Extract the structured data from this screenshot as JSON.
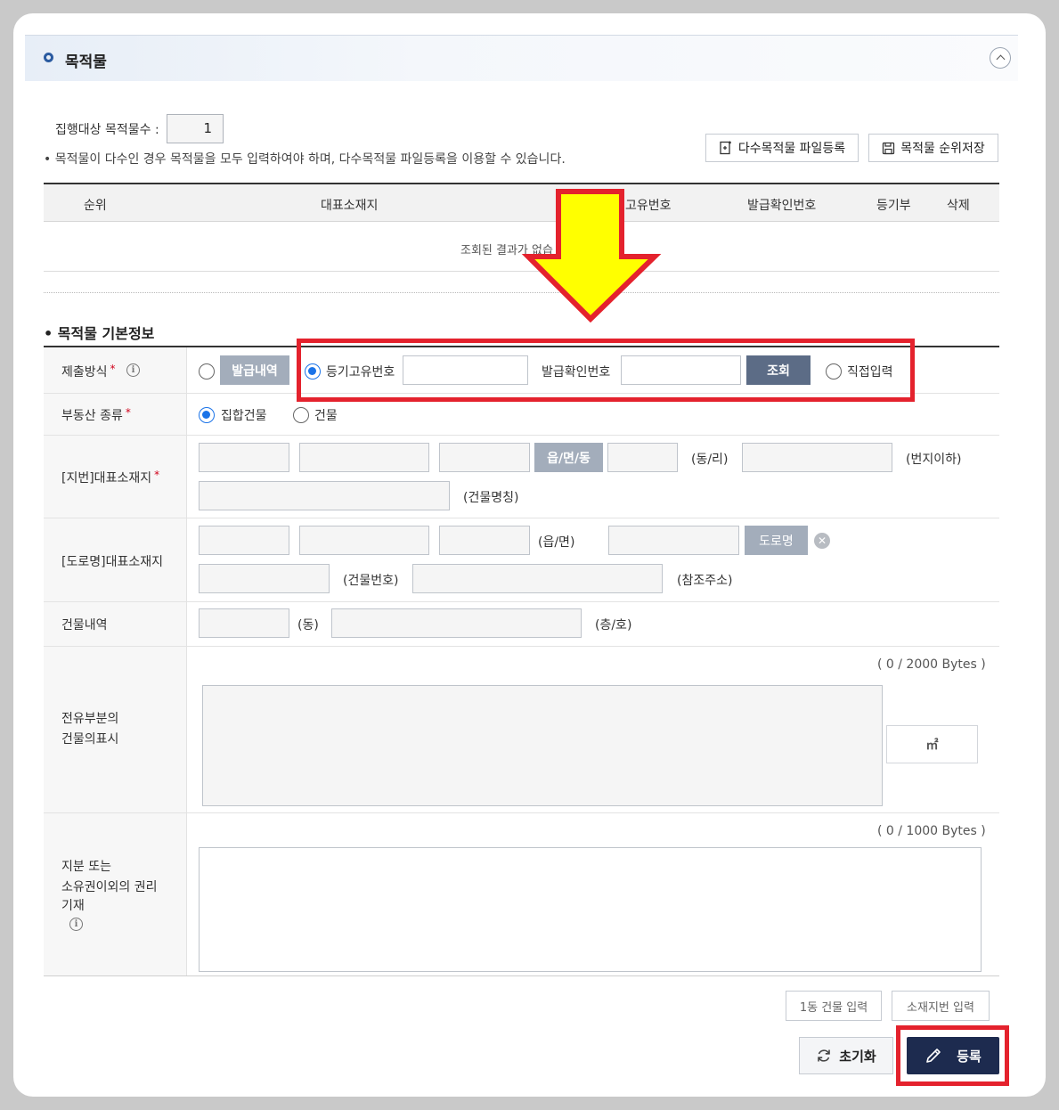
{
  "panel": {
    "title": "목적물"
  },
  "target_count": {
    "label": "집행대상 목적물수 :",
    "value": "1"
  },
  "notice": "목적물이 다수인 경우 목적물을 모두 입력하여야 하며, 다수목적물 파일등록을 이용할 수 있습니다.",
  "toolbar": {
    "bulk_upload": "다수목적물 파일등록",
    "save_order": "목적물 순위저장"
  },
  "grid": {
    "columns": [
      "순위",
      "대표소재지",
      "고유번호",
      "발급확인번호",
      "등기부",
      "삭제"
    ],
    "empty_message": "조회된 결과가 없습"
  },
  "basic_info": {
    "section_title": "목적물 기본정보",
    "submit_method": {
      "label": "제출방식",
      "issue_history": "발급내역",
      "registry_number": "등기고유번호",
      "issue_confirm_number": "발급확인번호",
      "search": "조회",
      "direct_input": "직접입력"
    },
    "property_type": {
      "label": "부동산 종류",
      "options": [
        "집합건물",
        "건물"
      ]
    },
    "lot_address": {
      "label": "[지번]대표소재지",
      "town_button": "읍/면/동",
      "dong_ri": "(동/리)",
      "lot_number": "(번지이하)",
      "building_name": "(건물명칭)"
    },
    "road_address": {
      "label": "[도로명]대표소재지",
      "eup_myeon": "(읍/면)",
      "road_button": "도로명",
      "building_number": "(건물번호)",
      "reference_address": "(참조주소)"
    },
    "building_detail": {
      "label": "건물내역",
      "dong": "(동)",
      "floor_ho": "(층/호)"
    },
    "exclusive_part": {
      "label_line1": "전유부분의",
      "label_line2": "건물의표시",
      "bytes": "( 0 / 2000 Bytes )",
      "unit": "㎡"
    },
    "share_rights": {
      "label_line1": "지분 또는",
      "label_line2": "소유권이외의 권리",
      "label_line3": "기재",
      "bytes": "( 0 / 1000 Bytes )"
    }
  },
  "actions": {
    "one_building": "1동 건물 입력",
    "lot_input": "소재지번 입력",
    "reset": "초기화",
    "submit": "등록"
  },
  "colors": {
    "accent_dark": "#1d2b4f",
    "highlight_red": "#e4222d",
    "arrow_yellow": "#ffff00",
    "radio_blue": "#1a73e8"
  }
}
